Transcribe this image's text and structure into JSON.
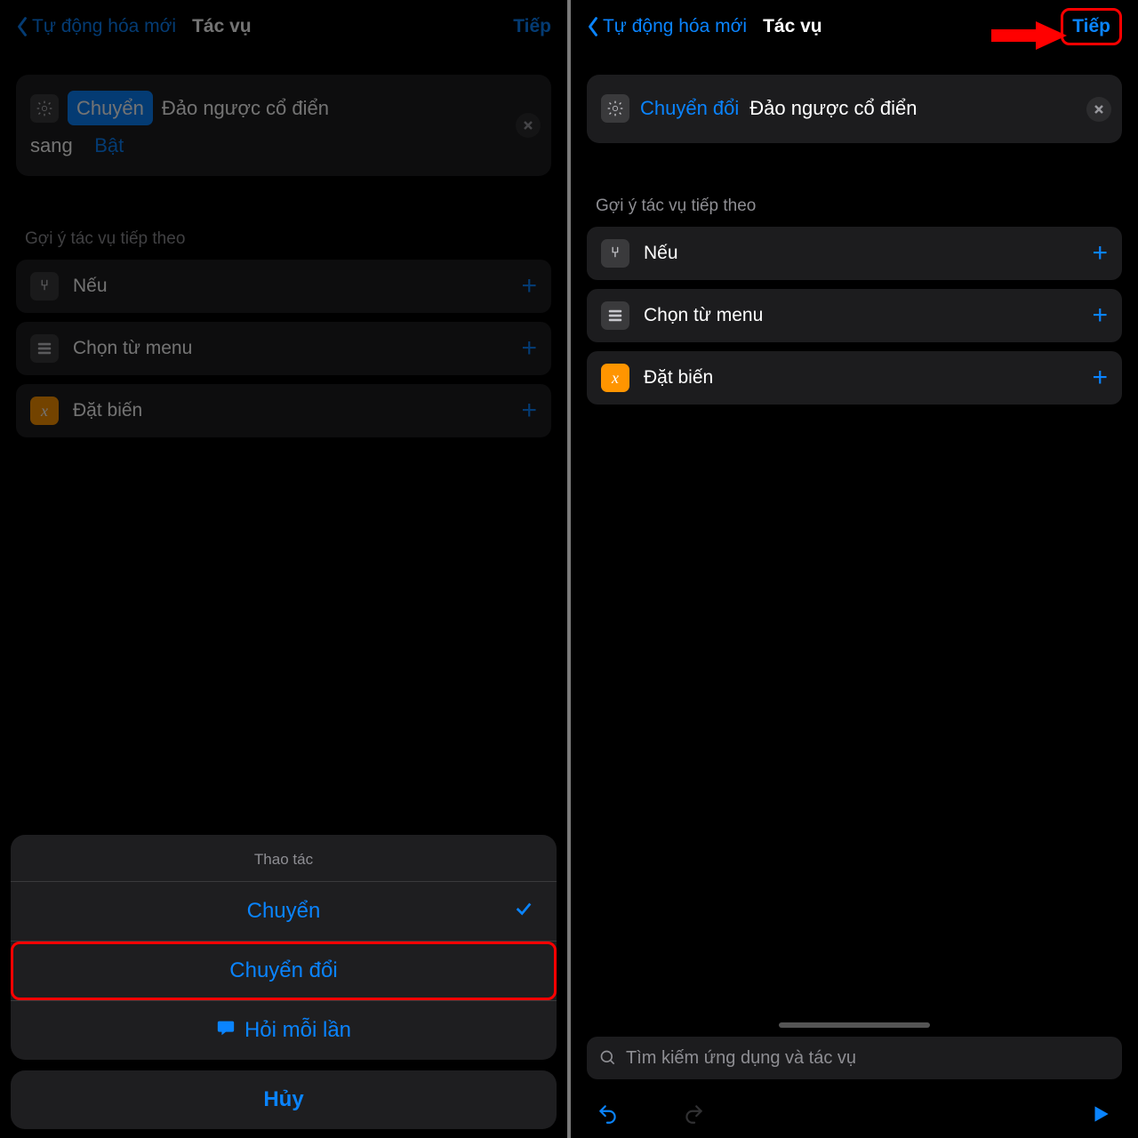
{
  "left": {
    "nav": {
      "back": "Tự động hóa mới",
      "title": "Tác vụ",
      "next": "Tiếp"
    },
    "card": {
      "chip": "Chuyển",
      "text_after_chip": "Đảo ngược cổ điển",
      "second_line_prefix": "sang",
      "second_line_link": "Bật"
    },
    "section_label": "Gợi ý tác vụ tiếp theo",
    "suggestions": [
      {
        "label": "Nếu"
      },
      {
        "label": "Chọn từ menu"
      },
      {
        "label": "Đặt biến"
      }
    ],
    "sheet": {
      "title": "Thao tác",
      "row_switch": "Chuyển",
      "row_toggle": "Chuyển đổi",
      "row_ask": "Hỏi mỗi lần",
      "cancel": "Hủy"
    }
  },
  "right": {
    "nav": {
      "back": "Tự động hóa mới",
      "title": "Tác vụ",
      "next": "Tiếp"
    },
    "card": {
      "link": "Chuyển đổi",
      "rest": "Đảo ngược cổ điển"
    },
    "section_label": "Gợi ý tác vụ tiếp theo",
    "suggestions": [
      {
        "label": "Nếu"
      },
      {
        "label": "Chọn từ menu"
      },
      {
        "label": "Đặt biến"
      }
    ],
    "search_placeholder": "Tìm kiếm ứng dụng và tác vụ"
  }
}
